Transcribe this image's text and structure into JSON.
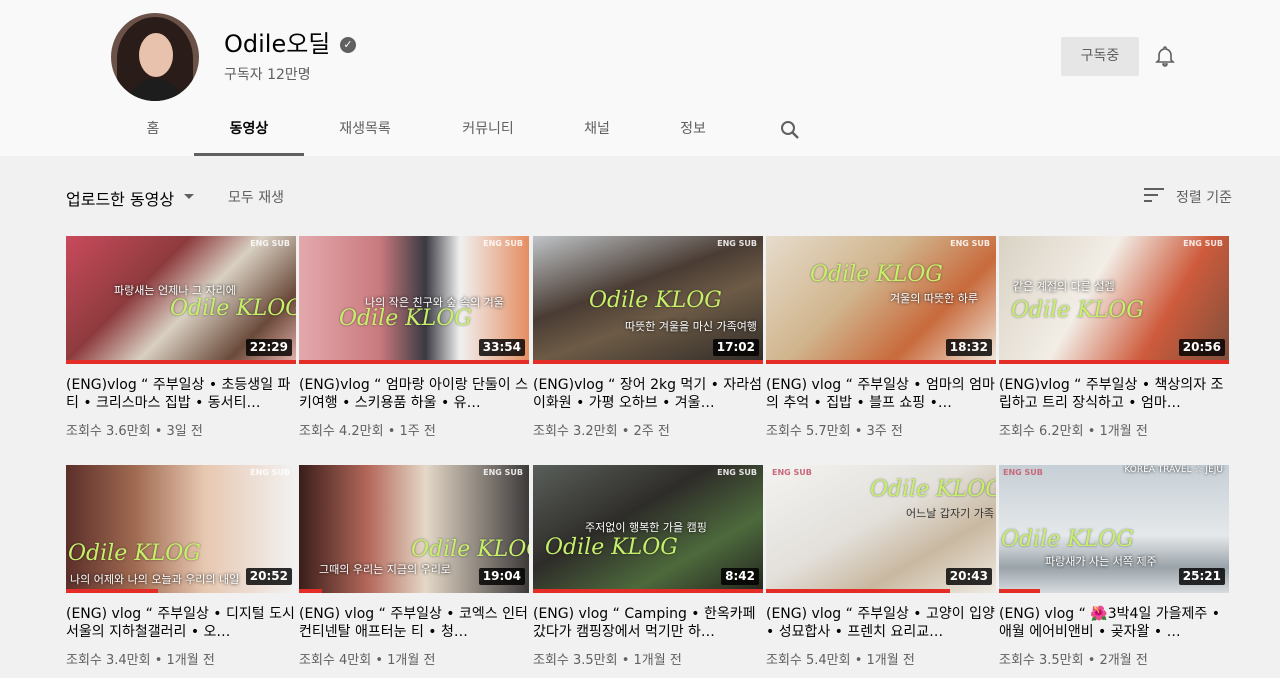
{
  "channel": {
    "name": "Odile오딜",
    "subscribers": "구독자 12만명",
    "subscribe_label": "구독중"
  },
  "tabs": [
    "홈",
    "동영상",
    "재생목록",
    "커뮤니티",
    "채널",
    "정보"
  ],
  "filter": {
    "uploads_label": "업로드한 동영상",
    "play_all_label": "모두 재생",
    "sort_label": "정렬 기준"
  },
  "videos": [
    {
      "title": "(ENG)vlog “ 주부일상 • 초등생일 파티 • 크리스마스 집밥 • 동서티…",
      "meta": "조회수 3.6만회 • 3일 전",
      "duration": "22:29",
      "eng_sub": "ENG SUB",
      "overlay": "Odile KLOG",
      "caption": "파랑새는 언제나 그 자리에"
    },
    {
      "title": "(ENG)vlog “ 엄마랑 아이랑 단둘이 스키여행 • 스키용품 하울 • 유…",
      "meta": "조회수 4.2만회 • 1주 전",
      "duration": "33:54",
      "eng_sub": "ENG SUB",
      "overlay": "Odile KLOG",
      "caption": "나의 작은 친구와 숲 속의 겨울"
    },
    {
      "title": "(ENG)vlog “ 장어 2kg 먹기 • 자라섬 이화원 • 가평 오하브 • 겨울…",
      "meta": "조회수 3.2만회 • 2주 전",
      "duration": "17:02",
      "eng_sub": "ENG SUB",
      "overlay": "Odile KLOG",
      "caption": "따뜻한 겨울을 마신 가족여행"
    },
    {
      "title": "(ENG) vlog “ 주부일상 • 엄마의 엄마의 추억 • 집밥 • 블프 쇼핑 •…",
      "meta": "조회수 5.7만회 • 3주 전",
      "duration": "18:32",
      "eng_sub": "ENG SUB",
      "overlay": "Odile KLOG",
      "caption": "겨울의 따뜻한 하루"
    },
    {
      "title": "(ENG)vlog “ 주부일상 • 책상의자 조립하고 트리 장식하고 • 엄마…",
      "meta": "조회수 6.2만회 • 1개월 전",
      "duration": "20:56",
      "eng_sub": "ENG SUB",
      "overlay": "Odile KLOG",
      "caption": "같은 계절의 다른 설렘"
    },
    {
      "title": "(ENG) vlog “ 주부일상 • 디지털 도시 서울의 지하철갤러리 • 오…",
      "meta": "조회수 3.4만회 • 1개월 전",
      "duration": "20:52",
      "eng_sub": "ENG SUB",
      "overlay": "Odile KLOG",
      "caption": "나의 어제와 나의 오늘과 우리의 내일"
    },
    {
      "title": "(ENG) vlog “ 주부일상 • 코엑스 인터컨티넨탈 애프터눈 티 • 청…",
      "meta": "조회수 4만회 • 1개월 전",
      "duration": "19:04",
      "eng_sub": "ENG SUB",
      "overlay": "Odile KLOG",
      "caption": "그때의 우리는 지금의 우리로"
    },
    {
      "title": "(ENG) vlog “ Camping • 한옥카페 갔다가 캠핑장에서 먹기만 하…",
      "meta": "조회수 3.5만회 • 1개월 전",
      "duration": "8:42",
      "eng_sub": "ENG SUB",
      "overlay": "Odile KLOG",
      "caption": "주저없이 행복한 가을 캠핑"
    },
    {
      "title": "(ENG) vlog “ 주부일상 • 고양이 입양 • 성묘합사 • 프렌치 요리교…",
      "meta": "조회수 5.4만회 • 1개월 전",
      "duration": "20:43",
      "eng_sub": "ENG SUB",
      "overlay": "Odile KLOG",
      "caption": "어느날 갑자기 가족"
    },
    {
      "title": "(ENG) vlog “ 🌺3박4일 가을제주 • 애월 에어비앤비 • 곶자왈 • …",
      "meta": "조회수 3.5만회 • 2개월 전",
      "duration": "25:21",
      "eng_sub": "ENG SUB",
      "overlay": "Odile KLOG",
      "caption": "파랑새가 사는 서쪽 제주",
      "extra": "KOREA TRAVEL ☆ JEJU"
    }
  ]
}
